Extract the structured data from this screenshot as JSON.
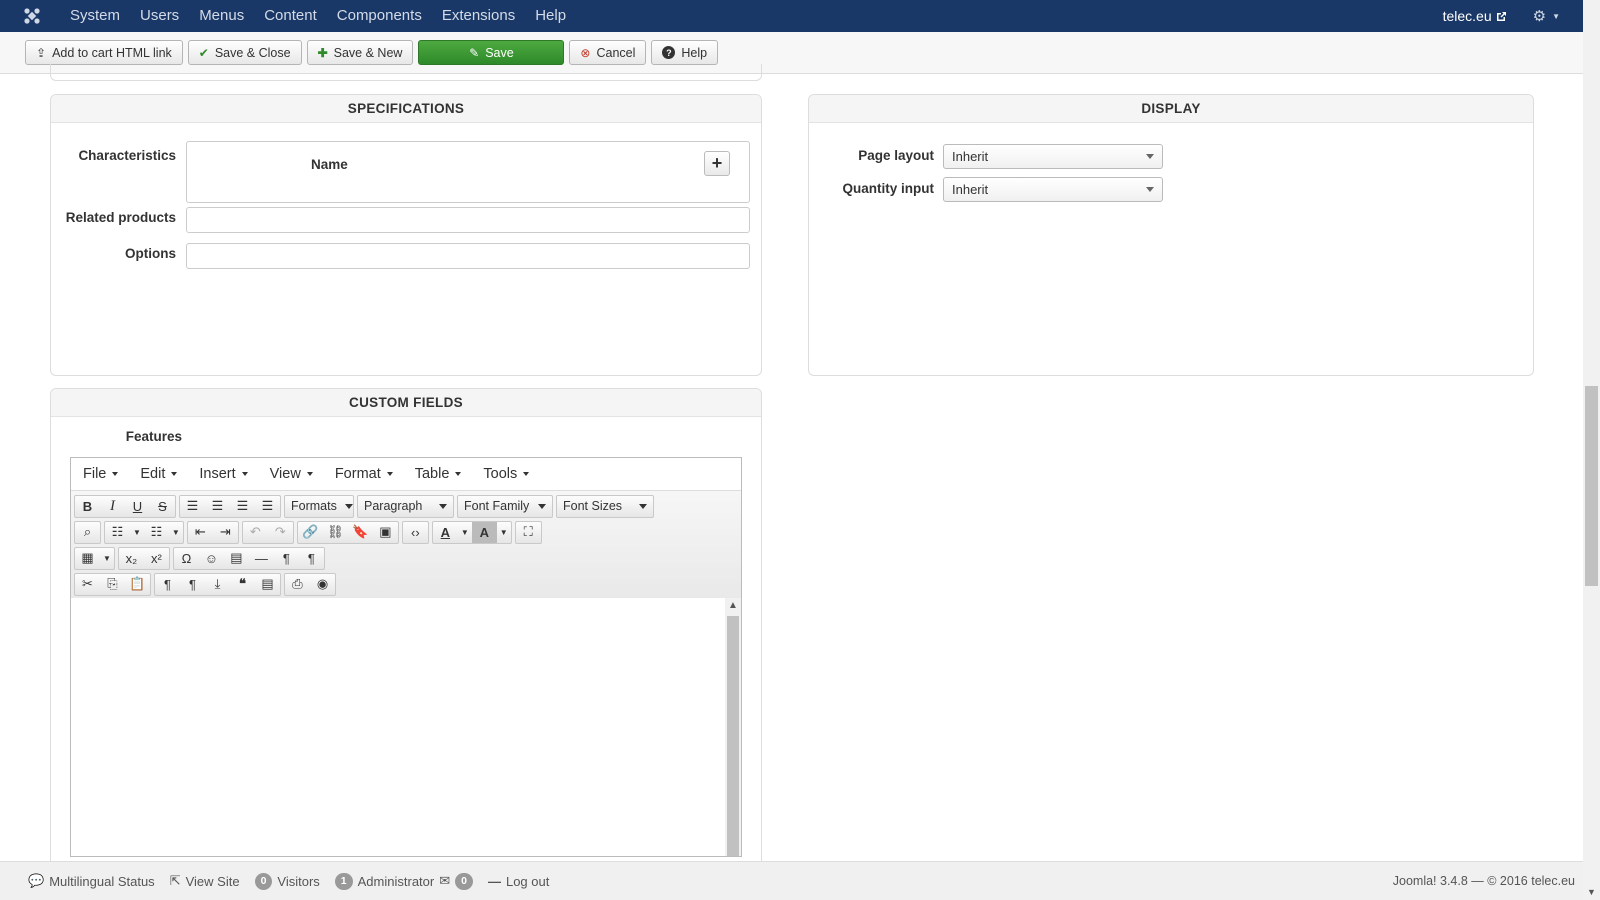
{
  "navbar": {
    "menu": [
      "System",
      "Users",
      "Menus",
      "Content",
      "Components",
      "Extensions",
      "Help"
    ],
    "site_name": "telec.eu"
  },
  "toolbar": {
    "add_cart": "Add to cart HTML link",
    "save_close": "Save & Close",
    "save_new": "Save & New",
    "save": "Save",
    "cancel": "Cancel",
    "help": "Help"
  },
  "specifications": {
    "title": "SPECIFICATIONS",
    "characteristics_label": "Characteristics",
    "name_header": "Name",
    "related_label": "Related products",
    "options_label": "Options"
  },
  "display": {
    "title": "DISPLAY",
    "page_layout_label": "Page layout",
    "page_layout_value": "Inherit",
    "quantity_label": "Quantity input",
    "quantity_value": "Inherit"
  },
  "custom_fields": {
    "title": "CUSTOM FIELDS",
    "features_label": "Features"
  },
  "editor": {
    "menus": [
      "File",
      "Edit",
      "Insert",
      "View",
      "Format",
      "Table",
      "Tools"
    ],
    "lists": [
      "Formats",
      "Paragraph",
      "Font Family",
      "Font Sizes"
    ]
  },
  "status": {
    "multilingual": "Multilingual Status",
    "view_site": "View Site",
    "visitors_count": "0",
    "visitors": "Visitors",
    "admin_count": "1",
    "admin": "Administrator",
    "messages_count": "0",
    "logout": "Log out",
    "copyright": "Joomla! 3.4.8 — © 2016 telec.eu"
  }
}
